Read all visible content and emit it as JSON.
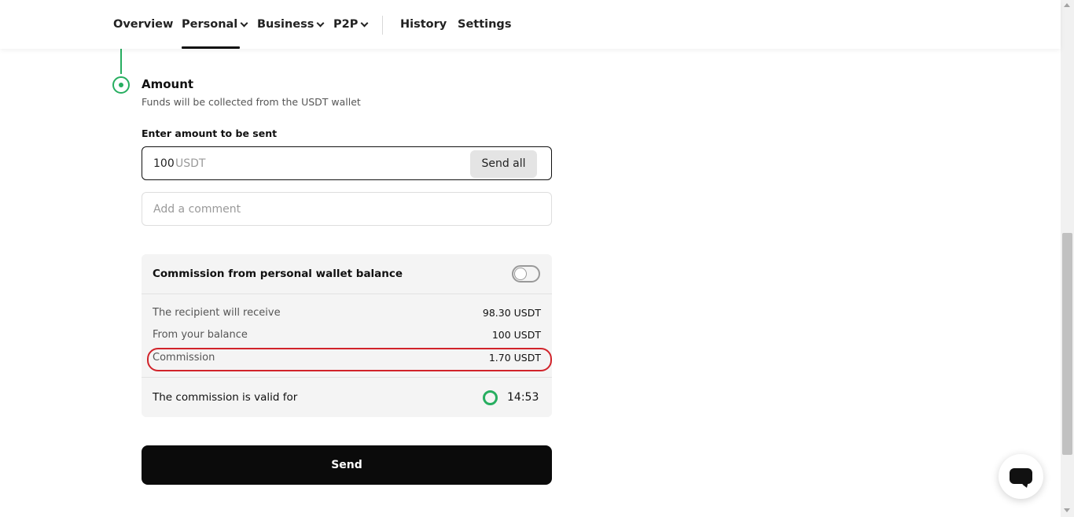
{
  "nav": {
    "overview": "Overview",
    "personal": "Personal",
    "business": "Business",
    "p2p": "P2P",
    "history": "History",
    "settings": "Settings"
  },
  "step": {
    "title": "Amount",
    "subtitle": "Funds will be collected from the USDT wallet"
  },
  "amount": {
    "label": "Enter amount to be sent",
    "value": "100",
    "currency": "USDT",
    "send_all": "Send all"
  },
  "comment": {
    "placeholder": "Add a comment"
  },
  "commission": {
    "toggle_label": "Commission from personal wallet balance",
    "toggle_on": false,
    "rows": [
      {
        "label": "The recipient will receive",
        "value": "98.30 USDT"
      },
      {
        "label": "From your balance",
        "value": "100 USDT"
      },
      {
        "label": "Commission",
        "value": "1.70 USDT"
      }
    ],
    "valid_label": "The commission is valid for",
    "timer": "14:53"
  },
  "send_button": "Send",
  "colors": {
    "accent_green": "#27ae60",
    "highlight_red": "#d1232a",
    "button_black": "#0b0b0b"
  }
}
